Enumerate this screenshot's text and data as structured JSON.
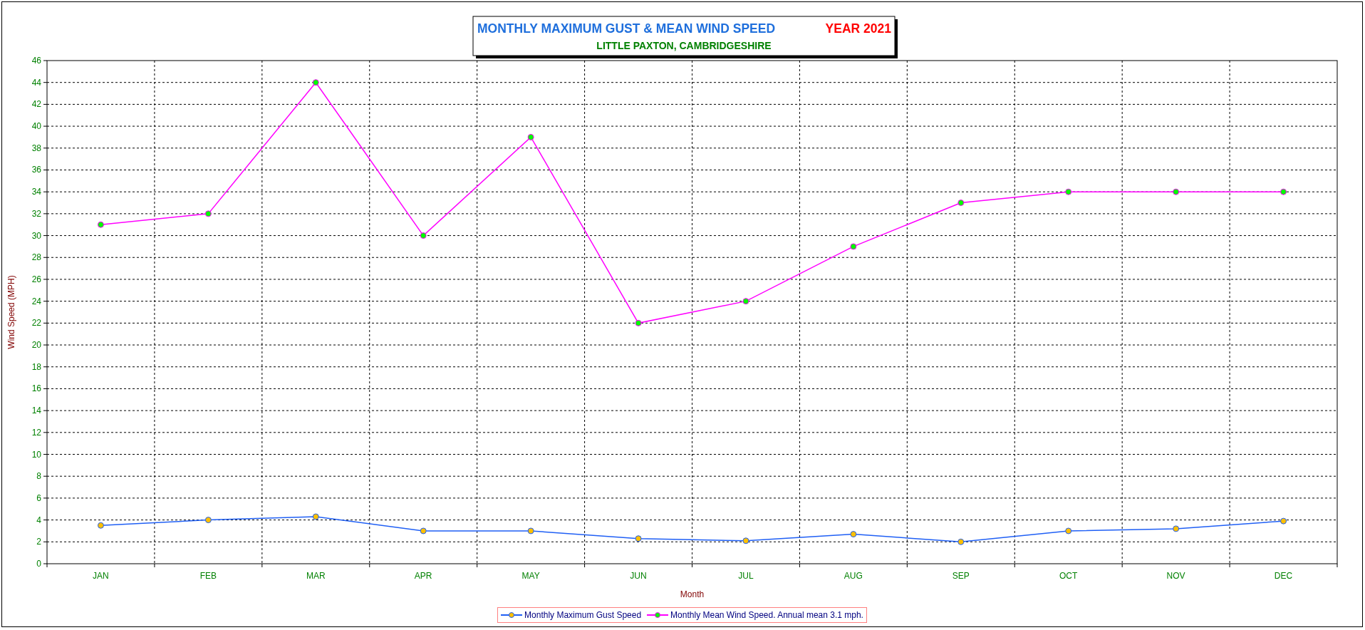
{
  "chart": {
    "title": "MONTHLY MAXIMUM GUST & MEAN WIND SPEED",
    "year_label": "YEAR 2021",
    "subtitle": "LITTLE PAXTON, CAMBRIDGESHIRE",
    "chart_data": {
      "type": "line",
      "xlabel": "Month",
      "ylabel": "Wind Speed (MPH)",
      "categories": [
        "JAN",
        "FEB",
        "MAR",
        "APR",
        "MAY",
        "JUN",
        "JUL",
        "AUG",
        "SEP",
        "OCT",
        "NOV",
        "DEC"
      ],
      "ylim": [
        0,
        46
      ],
      "grid": {
        "x": true,
        "y": true
      },
      "legend": true,
      "yticks": [
        0,
        2,
        4,
        6,
        8,
        10,
        12,
        14,
        16,
        18,
        20,
        22,
        24,
        26,
        28,
        30,
        32,
        34,
        36,
        38,
        40,
        42,
        44,
        46
      ],
      "series": [
        {
          "name": "Monthly Maximum Gust Speed",
          "color": "#1f5ff5",
          "marker": "circle",
          "values": [
            3.5,
            4,
            4.3,
            3,
            3,
            2.3,
            2.1,
            2.7,
            2,
            3,
            3.2,
            3.9
          ]
        },
        {
          "name": "Monthly Mean Wind Speed. Annual mean 3.1 mph.",
          "color": "#ff00ff",
          "marker": "circle",
          "values": [
            31,
            32,
            44,
            30,
            39,
            22,
            24,
            29,
            33,
            34,
            34,
            34
          ]
        }
      ]
    }
  }
}
